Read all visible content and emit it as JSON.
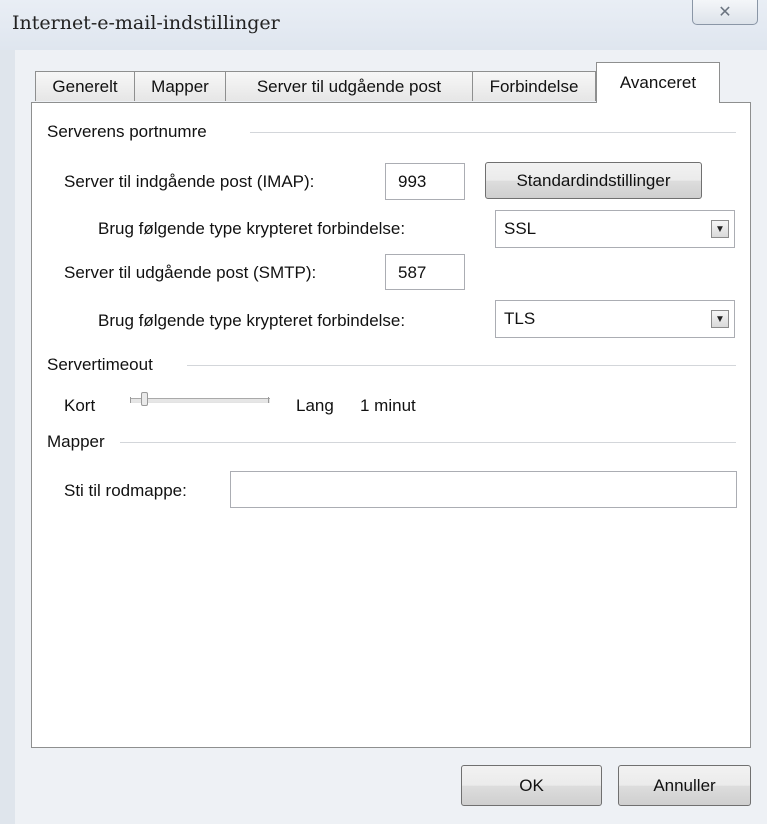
{
  "window": {
    "title": "Internet-e-mail-indstillinger",
    "close_glyph": "✕"
  },
  "tabs": [
    {
      "label": "Generelt",
      "active": false
    },
    {
      "label": "Mapper",
      "active": false
    },
    {
      "label": "Server til udgående post",
      "active": false
    },
    {
      "label": "Forbindelse",
      "active": false
    },
    {
      "label": "Avanceret",
      "active": true
    }
  ],
  "ports": {
    "group_label": "Serverens portnumre",
    "incoming_label": "Server til indgående post (IMAP):",
    "incoming_value": "993",
    "defaults_button": "Standardindstillinger",
    "encryption_label_1": "Brug følgende type krypteret forbindelse:",
    "encryption_value_1": "SSL",
    "outgoing_label": "Server til udgående post (SMTP):",
    "outgoing_value": "587",
    "encryption_label_2": "Brug følgende type krypteret forbindelse:",
    "encryption_value_2": "TLS"
  },
  "timeout": {
    "group_label": "Servertimeout",
    "short_label": "Kort",
    "long_label": "Lang",
    "value_text": "1 minut",
    "slider_fraction": 0.08
  },
  "folders": {
    "group_label": "Mapper",
    "root_label": "Sti til rodmappe:",
    "root_value": ""
  },
  "footer": {
    "ok_label": "OK",
    "cancel_label": "Annuller"
  }
}
